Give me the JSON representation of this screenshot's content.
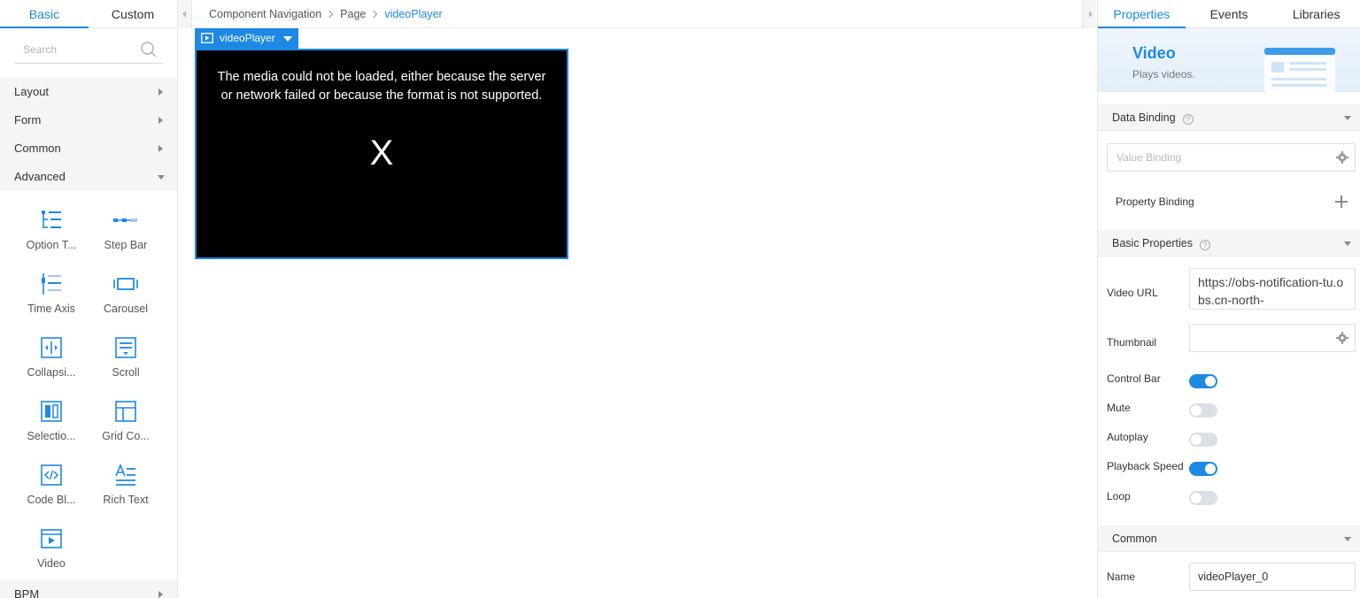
{
  "left_panel": {
    "tabs": [
      "Basic",
      "Custom"
    ],
    "search_placeholder": "Search",
    "categories": [
      "Layout",
      "Form",
      "Common",
      "Advanced"
    ],
    "components": [
      "Option T...",
      "Step Bar",
      "Time Axis",
      "Carousel",
      "Collapsi...",
      "Scroll",
      "Selectio...",
      "Grid Co...",
      "Code Bl...",
      "Rich Text",
      "Video"
    ],
    "bottom_category": "BPM"
  },
  "breadcrumb": {
    "items": [
      "Component Navigation",
      "Page",
      "videoPlayer"
    ]
  },
  "canvas": {
    "component_tag": "videoPlayer",
    "video_error_line1": "The media could not be loaded, either because the server",
    "video_error_line2": "or network failed or because the format is not supported.",
    "video_error_mark": "X"
  },
  "right_panel": {
    "tabs": [
      "Properties",
      "Events",
      "Libraries"
    ],
    "hero_title": "Video",
    "hero_subtitle": "Plays videos.",
    "data_binding": {
      "title": "Data Binding",
      "value_binding_placeholder": "Value Binding",
      "property_binding_label": "Property Binding"
    },
    "basic_properties": {
      "title": "Basic Properties",
      "video_url_label": "Video URL",
      "video_url_value": "https://obs-notification-tu.obs.cn-north-",
      "thumbnail_label": "Thumbnail",
      "thumbnail_value": "",
      "toggles": [
        {
          "label": "Control Bar",
          "on": true
        },
        {
          "label": "Mute",
          "on": false
        },
        {
          "label": "Autoplay",
          "on": false
        },
        {
          "label": "Playback Speed",
          "on": true
        },
        {
          "label": "Loop",
          "on": false
        }
      ]
    },
    "common": {
      "title": "Common",
      "name_label": "Name",
      "name_value": "videoPlayer_0"
    }
  },
  "colors": {
    "accent": "#1e88e5",
    "panel_bg": "#f4f5f7",
    "toggle_off": "#dcdfe6"
  }
}
